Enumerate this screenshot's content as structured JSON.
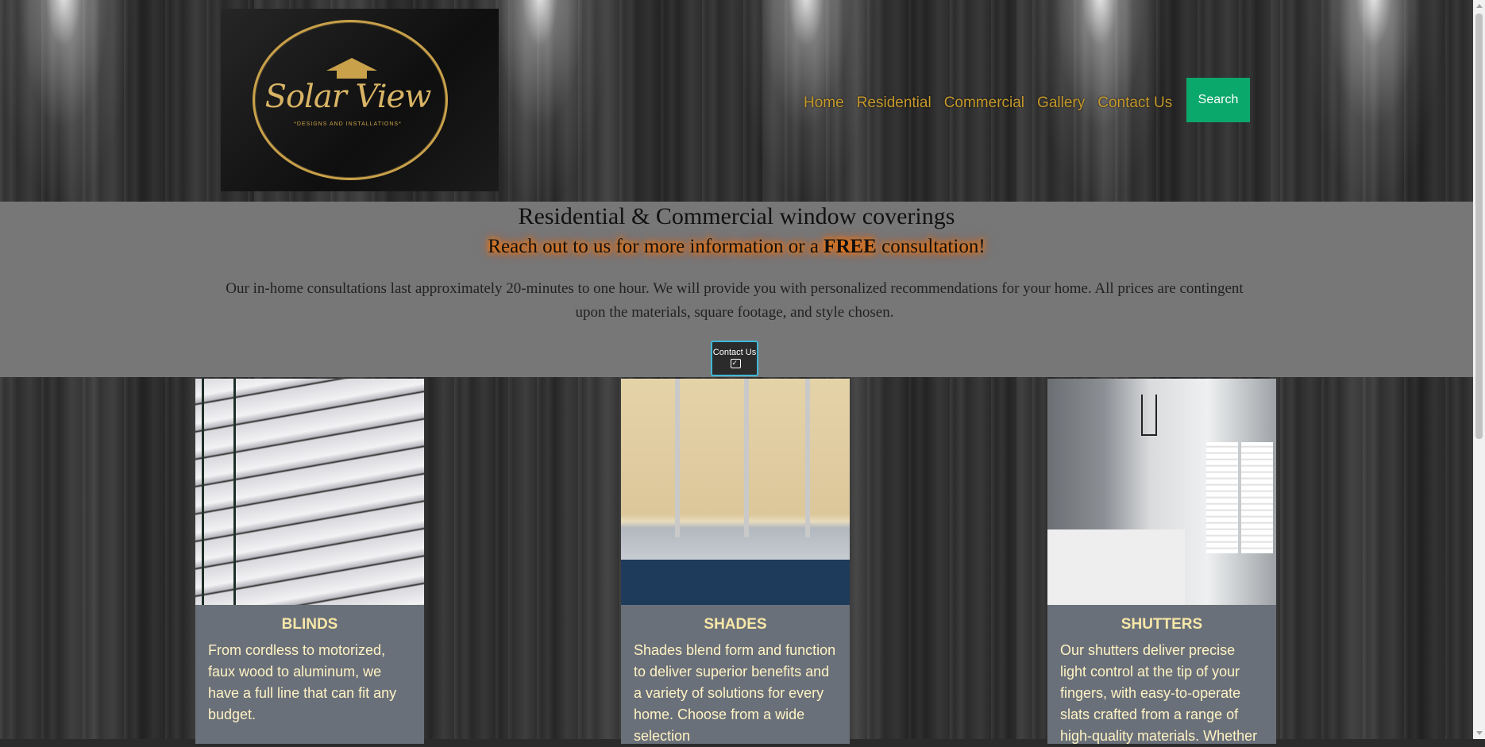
{
  "logo": {
    "name": "Solar View",
    "tagline": "*DESIGNS AND INSTALLATIONS*"
  },
  "nav": {
    "items": [
      "Home",
      "Residential",
      "Commercial",
      "Gallery",
      "Contact Us"
    ],
    "search_label": "Search"
  },
  "hero": {
    "title": "Residential & Commercial window coverings",
    "subtitle_before": "Reach out to us for more information or a ",
    "subtitle_bold": "FREE",
    "subtitle_after": " consultation!",
    "description": "Our in-home consultations last approximately 20-minutes to one hour. We will provide you with personalized recommendations for your home. All prices are contingent upon the materials, square footage, and style chosen.",
    "contact_button": "Contact Us"
  },
  "cards": [
    {
      "title": "BLINDS",
      "description": "From cordless to motorized, faux wood to aluminum, we have a full line that can fit any budget."
    },
    {
      "title": "SHADES",
      "description": "Shades blend form and function to deliver superior benefits and a variety of solutions for every home. Choose from a wide selection"
    },
    {
      "title": "SHUTTERS",
      "description": "Our shutters deliver precise light control at the tip of your fingers, with easy-to-operate slats crafted from a range of high-quality materials. Whether"
    }
  ],
  "colors": {
    "nav_link": "#c79a2b",
    "search_button": "#0aa86a",
    "band": "#777777",
    "card_body": "#6a7079",
    "card_title": "#f6e7a8",
    "glow": "#ff7a00"
  },
  "icons": {
    "contact_button_icon": "calendar-check-icon"
  }
}
